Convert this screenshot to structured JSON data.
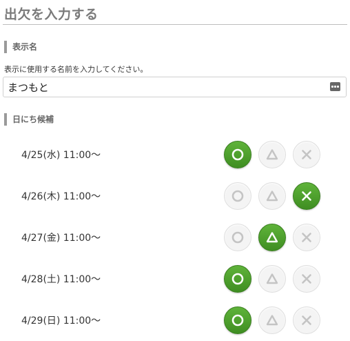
{
  "page": {
    "title": "出欠を入力する"
  },
  "display_name": {
    "heading": "表示名",
    "instruction": "表示に使用する名前を入力してください。",
    "value": "まつもと",
    "keyboard_icon": "keyboard-icon"
  },
  "dates": {
    "heading": "日にち候補",
    "rows": [
      {
        "label": "4/25(水) 11:00〜",
        "selected": "maru"
      },
      {
        "label": "4/26(木) 11:00〜",
        "selected": "batsu"
      },
      {
        "label": "4/27(金) 11:00〜",
        "selected": "sankaku"
      },
      {
        "label": "4/28(土) 11:00〜",
        "selected": "maru"
      },
      {
        "label": "4/29(日) 11:00〜",
        "selected": "maru"
      }
    ],
    "options": [
      {
        "key": "maru",
        "icon": "circle-icon"
      },
      {
        "key": "sankaku",
        "icon": "triangle-icon"
      },
      {
        "key": "batsu",
        "icon": "cross-icon"
      }
    ]
  },
  "colors": {
    "selected_green": "#4a9e2a",
    "unselected_gray": "#f4f4f4",
    "heading_bar": "#9a9a9a"
  }
}
